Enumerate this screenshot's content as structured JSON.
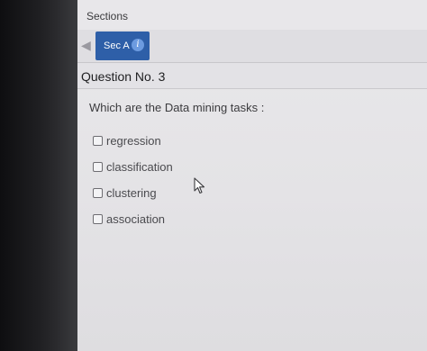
{
  "sections": {
    "label": "Sections"
  },
  "tabs": {
    "active_label": "Sec A",
    "info_icon": "i"
  },
  "question": {
    "number": "Question No. 3",
    "text": "Which are the Data mining tasks :"
  },
  "options": [
    {
      "label": "regression",
      "checked": false
    },
    {
      "label": "classification",
      "checked": false
    },
    {
      "label": "clustering",
      "checked": false
    },
    {
      "label": "association",
      "checked": false
    }
  ],
  "colors": {
    "accent": "#2e5fa8",
    "info": "#6c9be0"
  }
}
